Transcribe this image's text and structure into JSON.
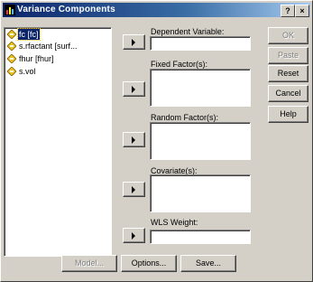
{
  "window": {
    "title": "Variance Components",
    "help_glyph": "?",
    "close_glyph": "×"
  },
  "variables": [
    {
      "label": "fc [fc]",
      "selected": true
    },
    {
      "label": "s.rfactant [surf...",
      "selected": false
    },
    {
      "label": "fhur [fhur]",
      "selected": false
    },
    {
      "label": "s.vol",
      "selected": false
    }
  ],
  "fields": {
    "dependent_label": "Dependent Variable:",
    "fixed_label": "Fixed Factor(s):",
    "random_label": "Random Factor(s):",
    "covariate_label": "Covariate(s):",
    "wls_label": "WLS Weight:"
  },
  "side_buttons": {
    "ok": "OK",
    "paste": "Paste",
    "reset": "Reset",
    "cancel": "Cancel",
    "help": "Help"
  },
  "bottom_buttons": {
    "model": "Model...",
    "options": "Options...",
    "save": "Save..."
  },
  "icons": {
    "window": "variance-window-icon",
    "variable": "scale-variable-icon",
    "move": "right-arrow-icon"
  },
  "colors": {
    "face": "#d4d0c8",
    "titlebar": "#0a246a",
    "selection": "#0a246a",
    "disabled_text": "#808080"
  }
}
